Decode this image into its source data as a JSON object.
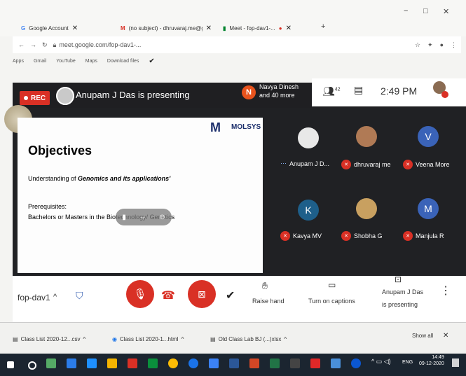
{
  "browser": {
    "tabs": [
      {
        "label": "Google Account",
        "icon": "google-icon"
      },
      {
        "label": "(no subject) - dhruvaraj.me@gmail.com",
        "icon": "gmail-icon"
      },
      {
        "label": "Meet - fop-dav1-...",
        "icon": "meet-icon"
      }
    ],
    "window_controls": {
      "minimize": "−",
      "maximize": "□",
      "close": "✕"
    },
    "address": "meet.google.com/fop-dav1-...",
    "bookmarks": [
      "Apps",
      "Gmail",
      "YouTube",
      "Maps",
      "Download files"
    ]
  },
  "meet": {
    "rec_label": "REC",
    "presenting_text": "Anupam J Das is presenting",
    "participants_initial": "N",
    "participants_line1": "Navya Dinesh",
    "participants_line2": "and 40 more",
    "people_count": "42",
    "time": "2:49 PM",
    "slide": {
      "logo": "MOLSYS",
      "logo_mark": "M",
      "title": "Objectives",
      "line1_prefix": "Understanding of ",
      "line1_bold": "Genomics and its applications'",
      "prereq_label": "Prerequisites:",
      "prereq_text": "Bachelors or Masters in the Biotechnology/ Genetics"
    },
    "tiles": [
      {
        "name": "Anupam J D...",
        "initial": ""
      },
      {
        "name": "dhruvaraj me",
        "initial": ""
      },
      {
        "name": "Veena More",
        "initial": "V"
      },
      {
        "name": "Kavya MV",
        "initial": "K"
      },
      {
        "name": "Shobha G",
        "initial": ""
      },
      {
        "name": "Manjula R",
        "initial": "M"
      }
    ],
    "meeting_code": "fop-dav1",
    "raise_hand": "Raise hand",
    "captions": "Turn on captions",
    "present_line1": "Anupam J Das",
    "present_line2": "is presenting"
  },
  "downloads": {
    "items": [
      "Class List 2020-12...csv",
      "Class List 2020-1...html",
      "Old Class Lab BJ (...)xlsx"
    ],
    "show_all": "Show all",
    "close": "✕"
  },
  "taskbar": {
    "lang": "ENG",
    "time": "14:49",
    "date": "09-12-2020"
  }
}
